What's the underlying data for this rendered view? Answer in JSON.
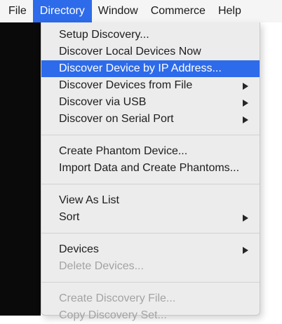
{
  "menubar": {
    "items": [
      "File",
      "Directory",
      "Window",
      "Commerce",
      "Help"
    ],
    "active_index": 1
  },
  "menu": {
    "groups": [
      [
        {
          "label": "Setup Discovery...",
          "submenu": false,
          "enabled": true
        },
        {
          "label": "Discover Local Devices Now",
          "submenu": false,
          "enabled": true
        },
        {
          "label": "Discover Device by IP Address...",
          "submenu": false,
          "enabled": true,
          "highlighted": true
        },
        {
          "label": "Discover Devices from File",
          "submenu": true,
          "enabled": true
        },
        {
          "label": "Discover via USB",
          "submenu": true,
          "enabled": true
        },
        {
          "label": "Discover on Serial Port",
          "submenu": true,
          "enabled": true
        }
      ],
      [
        {
          "label": "Create Phantom Device...",
          "submenu": false,
          "enabled": true
        },
        {
          "label": "Import Data and Create Phantoms...",
          "submenu": false,
          "enabled": true
        }
      ],
      [
        {
          "label": "View As List",
          "submenu": false,
          "enabled": true
        },
        {
          "label": "Sort",
          "submenu": true,
          "enabled": true
        }
      ],
      [
        {
          "label": "Devices",
          "submenu": true,
          "enabled": true
        },
        {
          "label": "Delete Devices...",
          "submenu": false,
          "enabled": false
        }
      ],
      [
        {
          "label": "Create Discovery File...",
          "submenu": false,
          "enabled": false
        },
        {
          "label": "Copy Discovery Set...",
          "submenu": false,
          "enabled": false
        }
      ]
    ]
  },
  "colors": {
    "highlight": "#2d6bea",
    "menu_background": "#ececec",
    "disabled_text": "#a3a3a3"
  }
}
